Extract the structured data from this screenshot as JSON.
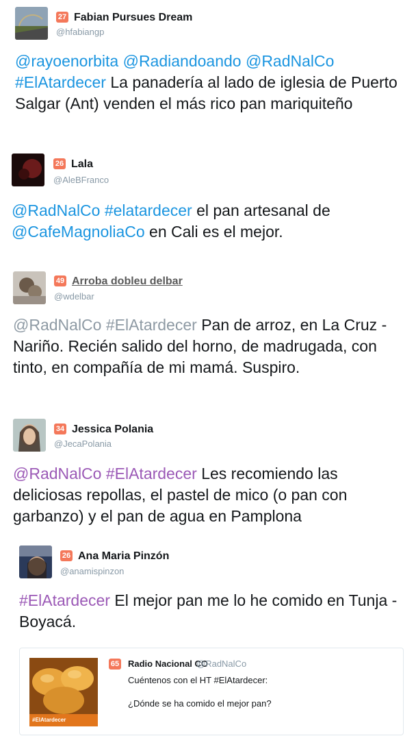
{
  "tweets": [
    {
      "count": "27",
      "name": "Fabian Pursues Dream",
      "handle": "@hfabiangp",
      "parts": [
        {
          "t": "@rayoenorbita @Radiandoando @RadNalCo #ElAtardecer",
          "k": "m"
        },
        {
          "t": " La panadería al lado de iglesia de Puerto Salgar (Ant) venden el más rico pan mariquiteño",
          "k": "p"
        }
      ]
    },
    {
      "count": "26",
      "name": "Lala",
      "handle": "@AleBFranco",
      "parts": [
        {
          "t": "@RadNalCo #elatardecer",
          "k": "m"
        },
        {
          "t": " el pan artesanal de ",
          "k": "p"
        },
        {
          "t": "@CafeMagnoliaCo",
          "k": "m"
        },
        {
          "t": " en Cali es el mejor.",
          "k": "p"
        }
      ]
    },
    {
      "count": "49",
      "name": "Arroba dobleu delbar",
      "handle": "@wdelbar",
      "parts": [
        {
          "t": "@RadNalCo #ElAtardecer",
          "k": "g"
        },
        {
          "t": " Pan de arroz, en La Cruz - Nariño. Recién salido del horno, de madrugada, con tinto, en compañía de mi mamá. Suspiro.",
          "k": "p"
        }
      ]
    },
    {
      "count": "34",
      "name": "Jessica Polania",
      "handle": "@JecaPolania",
      "parts": [
        {
          "t": "@RadNalCo #ElAtardecer",
          "k": "v"
        },
        {
          "t": " Les recomiendo las deliciosas repollas, el pastel de mico (o pan con garbanzo) y el pan de agua en Pamplona",
          "k": "p"
        }
      ]
    },
    {
      "count": "26",
      "name": "Ana Maria Pinzón",
      "handle": "@anamispinzon",
      "parts": [
        {
          "t": "#ElAtardecer",
          "k": "v"
        },
        {
          "t": " El mejor pan me lo he comido en Tunja - Boyacá.",
          "k": "p"
        }
      ]
    }
  ],
  "quoted": {
    "count": "65",
    "name": "Radio Nacional CO",
    "handle": "@RadNalCo",
    "line1": "Cuéntenos con el HT #ElAtardecer:",
    "line2": "¿Dónde se ha comido el mejor pan?",
    "image_caption": "#ElAtardecer"
  },
  "colors": {
    "badge": "#f4785a",
    "mention": "#1b95e0",
    "mention_grey": "#8e9aa4",
    "mention_purple": "#9b59b6",
    "handle": "#8899a6"
  }
}
